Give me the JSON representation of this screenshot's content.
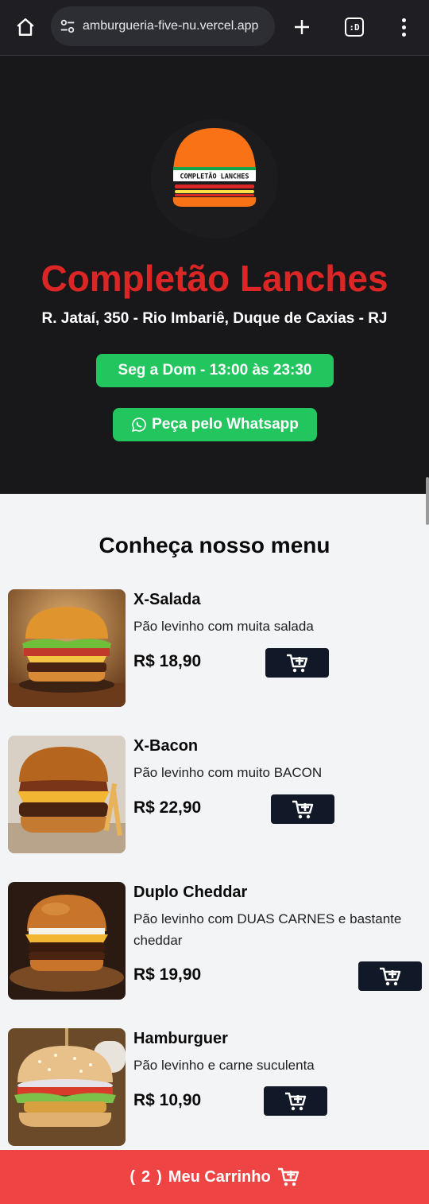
{
  "browser": {
    "url": "amburgueria-five-nu.vercel.app",
    "tab_indicator": ":D"
  },
  "hero": {
    "logo_text": "COMPLETÃO LANCHES",
    "title": "Completão Lanches",
    "address": "R. Jataí, 350 - Rio Imbariê, Duque de Caxias - RJ",
    "hours": "Seg a Dom - 13:00 às 23:30",
    "whatsapp_label": "Peça pelo Whatsapp"
  },
  "menu": {
    "title": "Conheça nosso menu",
    "items": [
      {
        "name": "X-Salada",
        "description": "Pão levinho com muita salada",
        "price": "R$ 18,90"
      },
      {
        "name": "X-Bacon",
        "description": "Pão levinho com muito BACON",
        "price": "R$ 22,90"
      },
      {
        "name": "Duplo Cheddar",
        "description": "Pão levinho com DUAS CARNES e bastante cheddar",
        "price": "R$ 19,90"
      },
      {
        "name": "Hamburguer",
        "description": "Pão levinho e carne suculenta",
        "price": "R$ 10,90"
      }
    ]
  },
  "cart": {
    "count": "2",
    "label": "Meu Carrinho"
  },
  "colors": {
    "brand_red": "#dc2626",
    "green": "#22c55e",
    "dark": "#18181b",
    "cart_red": "#ef4444",
    "button_dark": "#111827"
  }
}
